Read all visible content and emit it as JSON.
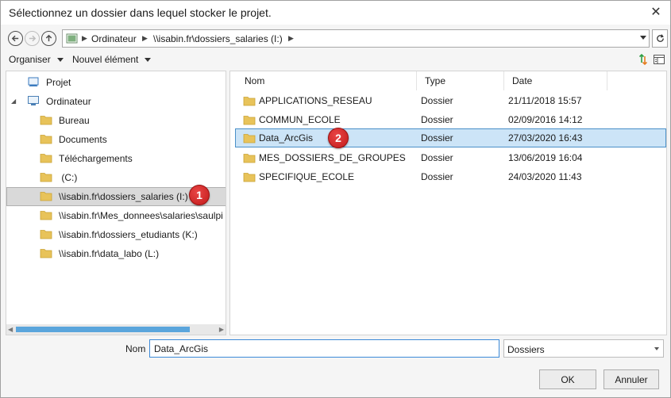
{
  "dialog": {
    "title": "Sélectionnez un dossier dans lequel stocker le projet.",
    "close_glyph": "✕"
  },
  "navigation": {
    "back_icon": "back-arrow-icon",
    "forward_icon": "forward-arrow-icon",
    "up_icon": "up-arrow-icon",
    "breadcrumb": [
      "Ordinateur",
      "\\\\isabin.fr\\dossiers_salaries (I:)"
    ],
    "refresh_icon": "refresh-icon"
  },
  "toolbar": {
    "organize_label": "Organiser",
    "new_item_label": "Nouvel élément",
    "sort_icon": "sort-arrows-icon",
    "view_icon": "view-details-icon"
  },
  "tree": {
    "items": [
      {
        "label": "Projet",
        "icon": "project-icon"
      },
      {
        "label": "Ordinateur",
        "icon": "computer-icon",
        "expander": "◢"
      },
      {
        "label": "Bureau",
        "icon": "folder-icon"
      },
      {
        "label": "Documents",
        "icon": "folder-icon"
      },
      {
        "label": "Téléchargements",
        "icon": "folder-icon"
      },
      {
        "label": " (C:)",
        "icon": "folder-icon"
      },
      {
        "label": "\\\\isabin.fr\\dossiers_salaries (I:)",
        "icon": "folder-icon",
        "selected": true
      },
      {
        "label": "\\\\isabin.fr\\Mes_donnees\\salaries\\saulpi",
        "icon": "folder-icon"
      },
      {
        "label": "\\\\isabin.fr\\dossiers_etudiants (K:)",
        "icon": "folder-icon"
      },
      {
        "label": "\\\\isabin.fr\\data_labo (L:)",
        "icon": "folder-icon"
      }
    ]
  },
  "files": {
    "columns": {
      "name": "Nom",
      "type": "Type",
      "date": "Date"
    },
    "rows": [
      {
        "name": "APPLICATIONS_RESEAU",
        "type": "Dossier",
        "date": "21/11/2018 15:57"
      },
      {
        "name": "COMMUN_ECOLE",
        "type": "Dossier",
        "date": "02/09/2016 14:12"
      },
      {
        "name": "Data_ArcGis",
        "type": "Dossier",
        "date": "27/03/2020 16:43",
        "selected": true
      },
      {
        "name": "MES_DOSSIERS_DE_GROUPES",
        "type": "Dossier",
        "date": "13/06/2019 16:04"
      },
      {
        "name": "SPECIFIQUE_ECOLE",
        "type": "Dossier",
        "date": "24/03/2020 11:43"
      }
    ]
  },
  "annotations": {
    "badge1": "1",
    "badge2": "2",
    "color": "#d62b2b"
  },
  "footer": {
    "name_label": "Nom",
    "name_value": "Data_ArcGis",
    "filter_value": "Dossiers",
    "ok_label": "OK",
    "cancel_label": "Annuler"
  },
  "colors": {
    "selection_blue": "#cce4f7",
    "selection_border": "#4a90c8",
    "folder_yellow": "#e8c35a",
    "scroll_thumb": "#5aa5dc"
  }
}
